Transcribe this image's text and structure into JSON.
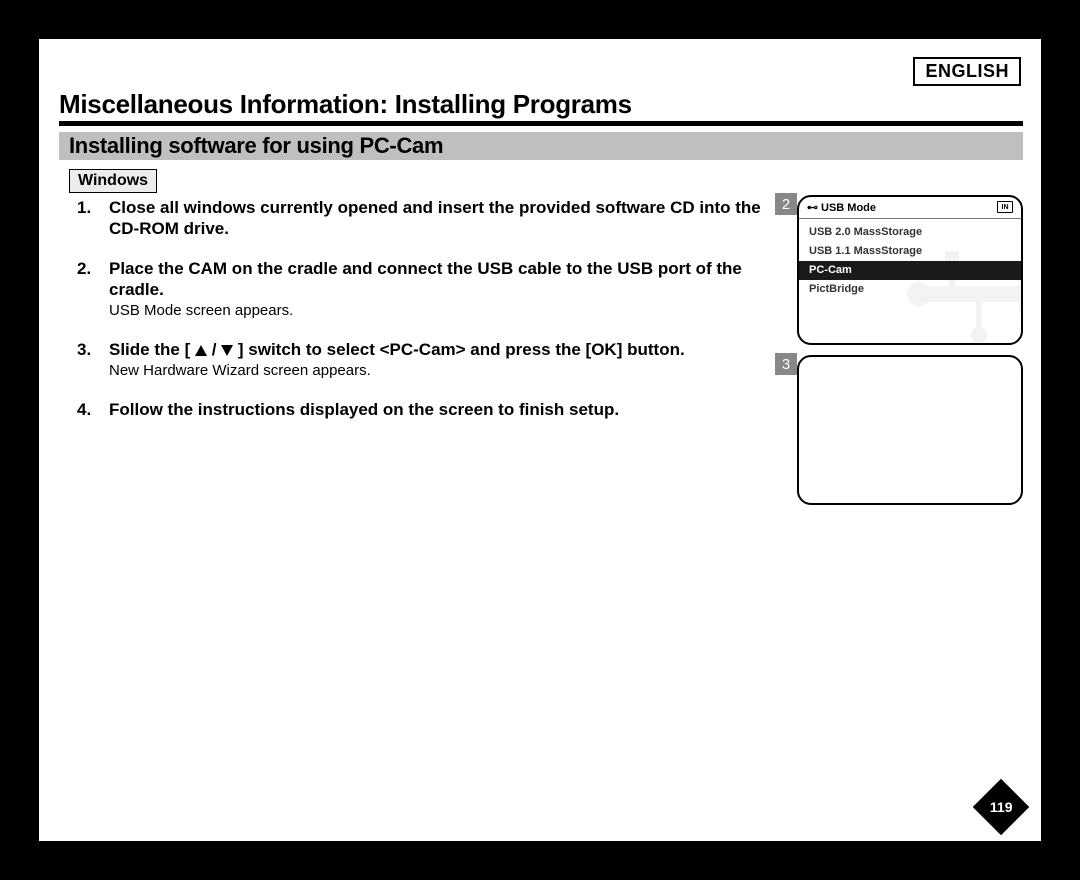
{
  "language_label": "ENGLISH",
  "page_title": "Miscellaneous Information: Installing Programs",
  "section_title": "Installing software for using PC-Cam",
  "os_label": "Windows",
  "steps": [
    {
      "n": "1.",
      "bold": "Close all windows currently opened and insert the provided software CD into the CD-ROM drive.",
      "sub": ""
    },
    {
      "n": "2.",
      "bold": "Place the CAM on the cradle and connect the USB cable to the USB port of the cradle.",
      "sub": "USB Mode screen appears."
    },
    {
      "n": "3.",
      "bold_pre": "Slide the [",
      "bold_post": "] switch to select <PC-Cam> and press the [OK] button.",
      "sub": "New Hardware Wizard screen appears."
    },
    {
      "n": "4.",
      "bold": "Follow the instructions displayed on the screen to finish setup.",
      "sub": ""
    }
  ],
  "figure_1": {
    "num": "2",
    "header": "USB Mode",
    "header_badge": "IN",
    "items": [
      {
        "label": "USB 2.0 MassStorage",
        "selected": false
      },
      {
        "label": "USB 1.1 MassStorage",
        "selected": false
      },
      {
        "label": "PC-Cam",
        "selected": true
      },
      {
        "label": "PictBridge",
        "selected": false
      }
    ]
  },
  "figure_2": {
    "num": "3"
  },
  "page_number": "119"
}
